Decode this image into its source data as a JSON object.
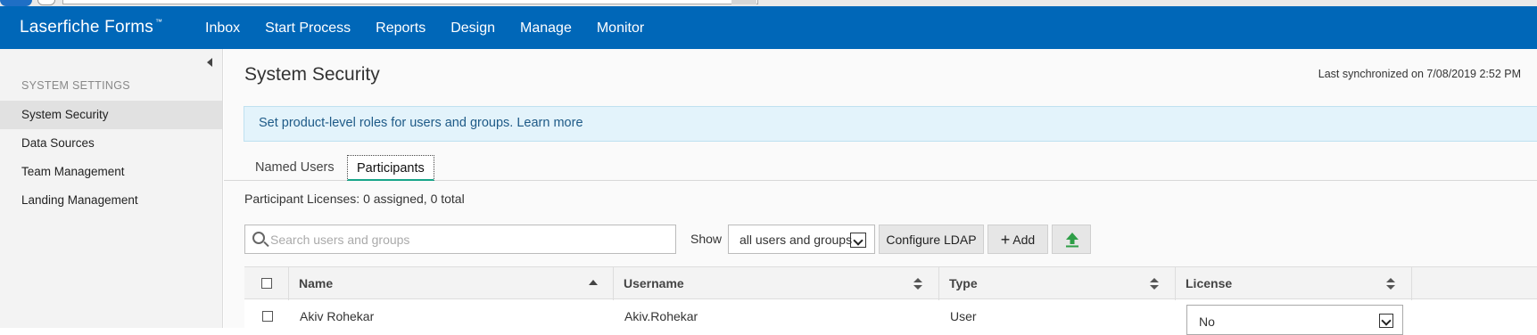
{
  "topbar": {
    "brand": "Laserfiche Forms",
    "brand_mark": "™",
    "nav": [
      "Inbox",
      "Start Process",
      "Reports",
      "Design",
      "Manage",
      "Monitor"
    ],
    "color": "#0067b8"
  },
  "sidebar": {
    "heading": "SYSTEM SETTINGS",
    "items": [
      {
        "label": "System Security",
        "active": true
      },
      {
        "label": "Data Sources",
        "active": false
      },
      {
        "label": "Team Management",
        "active": false
      },
      {
        "label": "Landing Management",
        "active": false
      }
    ]
  },
  "main": {
    "title": "System Security",
    "last_sync": "Last synchronized on 7/08/2019 2:52 PM",
    "info_text": "Set product-level roles for users and groups.",
    "info_link": "Learn more",
    "tabs": [
      {
        "label": "Named Users",
        "active": false
      },
      {
        "label": "Participants",
        "active": true
      }
    ],
    "licenses": "Participant Licenses: 0 assigned, 0 total",
    "toolbar": {
      "search_placeholder": "Search users and groups",
      "show_label": "Show",
      "show_value": "all users and groups",
      "configure_ldap": "Configure LDAP",
      "add_label": "Add",
      "add_glyph": "+",
      "upload_icon": "upload-arrow-icon",
      "upload_color": "#2e9e47"
    },
    "table": {
      "columns": [
        "Name",
        "Username",
        "Type",
        "License"
      ],
      "rows": [
        {
          "name": "Akiv Rohekar",
          "username": "Akiv.Rohekar",
          "type": "User",
          "license": "No"
        }
      ]
    }
  }
}
